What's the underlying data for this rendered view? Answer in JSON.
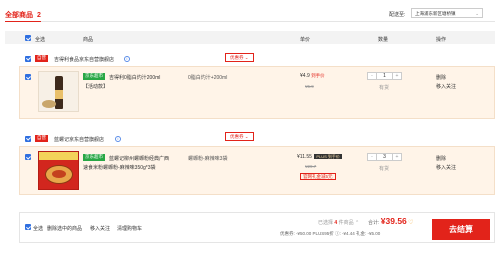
{
  "cart": {
    "all_title": "全部商品",
    "count": "2",
    "ship_label": "配送至:",
    "ship_location": "上海浦东新区塘桥镇"
  },
  "table_header": {
    "select_all": "全选",
    "product": "商品",
    "price": "单价",
    "quantity": "数量",
    "action": "操作"
  },
  "stores": [
    {
      "badge": "自营",
      "name": "吉得利食品京东自营旗舰店",
      "coupon": "优惠券",
      "item": {
        "tag": "京东超市",
        "title_1": "吉得利0脂白灼汁200ml",
        "title_2": "【活动款】",
        "spec": "0脂白灼汁+200ml",
        "price": "¥4.9",
        "price_note": "到手价",
        "orig_price": "¥5.9",
        "qty": "1",
        "stock": "有货",
        "delete": "删除",
        "follow": "移入关注"
      }
    },
    {
      "badge": "自营",
      "name": "蓝螺记京东自营旗舰店",
      "coupon": "优惠券",
      "item": {
        "tag": "京东超市",
        "title_1": "蓝螺记柳州螺蛳粉经典广西",
        "title_2": "速食米粉螺蛳粉-麻辣味350g*3袋",
        "spec": "螺蛳粉-麻辣味3袋",
        "price": "¥11.55",
        "plus_label": "PLUS 到手价",
        "orig_price": "¥29.7",
        "promo": "官网礼金减5元",
        "qty": "3",
        "stock": "有货",
        "delete": "删除",
        "follow": "移入关注"
      }
    }
  ],
  "footer": {
    "select_all": "全选",
    "delete_selected": "删除选中的商品",
    "move_follow": "移入关注",
    "clear_cart": "清理购物车",
    "selected_prefix": "已选择",
    "selected_count": "4",
    "selected_suffix": "件商品",
    "total_label": "合计:",
    "total": "¥39.56",
    "discount_line": "优惠券: -¥50.00  PLUS95折 ⓘ: -¥4.44  礼金: -¥5.00",
    "checkout": "去结算"
  },
  "colors": {
    "accent_red": "#e2231a",
    "checkbox_blue": "#2f6fe0",
    "item_bg": "#fff4e8",
    "jd_supermarket_green": "#28a745"
  }
}
